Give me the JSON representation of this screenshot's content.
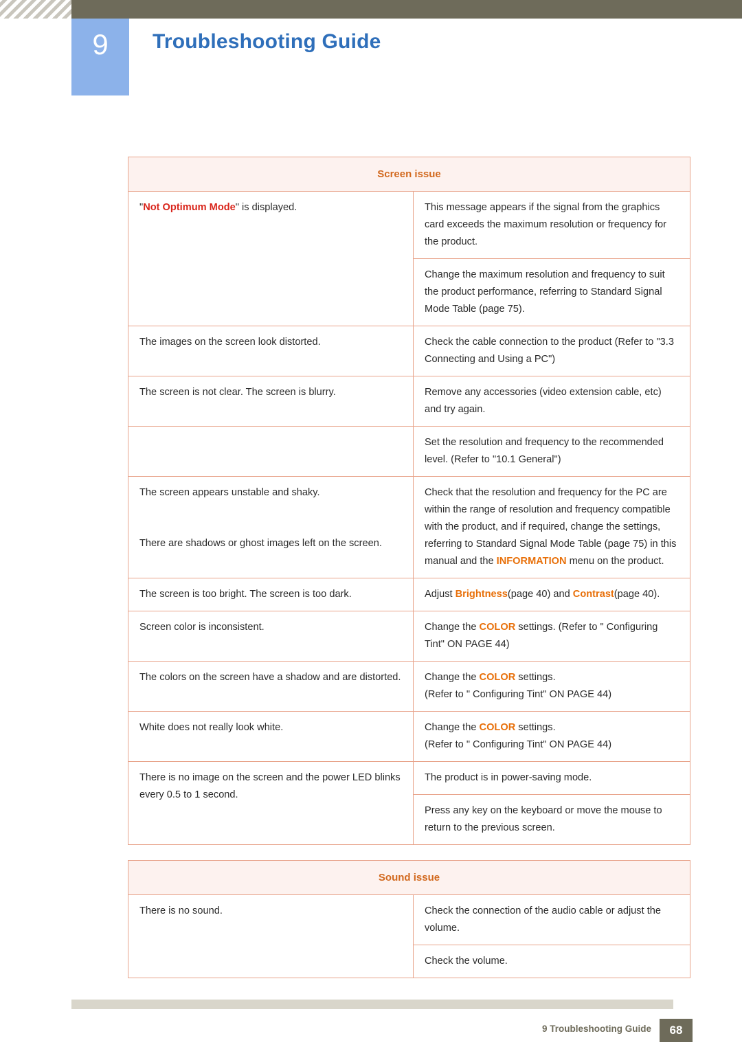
{
  "header": {
    "chapter_number": "9",
    "title": "Troubleshooting Guide"
  },
  "table": {
    "screen_section": "Screen issue",
    "sound_section": "Sound issue",
    "rows": [
      {
        "symptom_pre": "\"",
        "symptom_hl": "Not Optimum Mode",
        "symptom_post": "\" is displayed.",
        "solution": "This message appears if the signal from the graphics card exceeds the maximum resolution or frequency for the product."
      },
      {
        "symptom": "",
        "solution": "Change the maximum resolution and frequency to suit the product performance, referring to Standard Signal Mode Table (page 75)."
      },
      {
        "symptom": "The images on the screen look distorted.",
        "solution": "Check the cable connection to the product (Refer to \"3.3 Connecting and Using a PC\")"
      },
      {
        "symptom": "The screen is not clear. The screen is blurry.",
        "solution": "Remove any accessories (video extension cable, etc) and try again."
      },
      {
        "symptom": "",
        "solution": "Set the resolution and frequency to the recommended level. (Refer to \"10.1 General\")"
      },
      {
        "symptom": "The screen appears unstable and shaky.",
        "solution_part1": "Check that the resolution and frequency for the PC are within the range of resolution and frequency compatible with the product, and if required, change the settings, referring to Standard Signal Mode Table (page 75) in this manual and the ",
        "solution_hl": "INFORMATION",
        "solution_part2": " menu on the product."
      },
      {
        "symptom": "There are shadows or ghost images left on the screen."
      },
      {
        "symptom": "The screen is too bright. The screen is too dark.",
        "solution_pre": "Adjust ",
        "solution_hl1": "Brightness",
        "solution_mid": "(page 40) and ",
        "solution_hl2": "Contrast",
        "solution_post": "(page 40)."
      },
      {
        "symptom": "Screen color is inconsistent.",
        "solution_pre": "Change the ",
        "solution_hl": "COLOR",
        "solution_post": " settings. (Refer to \" Configuring Tint\" ON PAGE 44)"
      },
      {
        "symptom": "The colors on the screen have a shadow and are distorted.",
        "solution_pre": "Change the ",
        "solution_hl": "COLOR",
        "solution_post": " settings.",
        "solution_line2": "(Refer to \" Configuring Tint\" ON PAGE 44)"
      },
      {
        "symptom": "White does not really look white.",
        "solution_pre": "Change the ",
        "solution_hl": "COLOR",
        "solution_post": " settings.",
        "solution_line2": "(Refer to \" Configuring Tint\" ON PAGE 44)"
      },
      {
        "symptom": "There is no image on the screen and the power LED blinks every 0.5 to 1 second.",
        "solution": "The product is in power-saving mode."
      },
      {
        "symptom": "",
        "solution": "Press any key on the keyboard or move the mouse to return to the previous screen."
      },
      {
        "symptom": "There is no sound.",
        "solution": "Check the connection of the audio cable or adjust the volume."
      },
      {
        "symptom": "",
        "solution": "Check the volume."
      }
    ]
  },
  "footer": {
    "text": "9 Troubleshooting Guide",
    "page": "68"
  },
  "colors": {
    "header_band": "#6e6b5a",
    "chapter_box": "#8cb2ea",
    "title": "#2f6fba",
    "table_border": "#e8a38a",
    "section_bg": "#fdf2ef",
    "section_text": "#d2691e",
    "highlight_orange": "#e8700a",
    "highlight_red": "#d9261c"
  }
}
